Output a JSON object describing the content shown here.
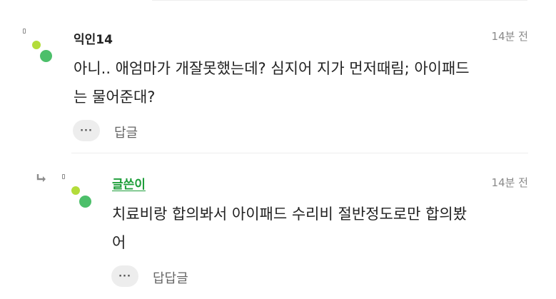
{
  "comments": [
    {
      "nickname": "익인14",
      "time": "14분 전",
      "content_line1": "아니.. 애엄마가 개잘못했는데? 심지어 지가 먼저때림; 아이패드",
      "content_line2": "는 물어준대?",
      "more_label": "···",
      "reply_label": "답글"
    },
    {
      "nickname": "글쓴이",
      "time": "14분 전",
      "content_line1": "치료비랑 합의봐서 아이패드 수리비 절반정도로만 합의봤",
      "content_line2": "어",
      "more_label": "···",
      "reply_label": "답답글"
    }
  ],
  "colors": {
    "author": "#1e9e3a",
    "avatar_light": "#b3dc3a",
    "avatar_dark": "#4cbf6a",
    "meta": "#8a8a8a"
  },
  "icons": {
    "reply_indicator": "reply-arrow-icon",
    "more": "more-dots-icon"
  }
}
